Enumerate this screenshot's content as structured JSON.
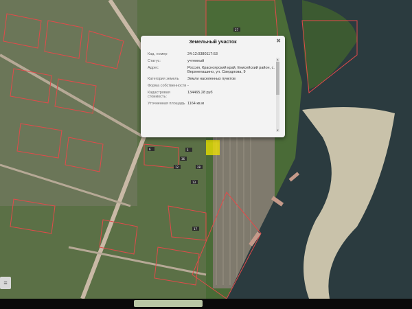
{
  "popup": {
    "title": "Земельный участок",
    "close_icon": "close-icon",
    "rows": [
      {
        "label": "Кад. номер",
        "value": "24:12:0380117:53"
      },
      {
        "label": "Статус:",
        "value": "учтенный"
      },
      {
        "label": "Адрес",
        "value": "Россия, Красноярский край, Енисейский район, с. Верхнепашино, ул. Свердлова, 9"
      },
      {
        "label": "Категория земель",
        "value": "Земли населенных пунктов"
      },
      {
        "label": "Форма собственности",
        "value": "-"
      },
      {
        "label": "Кадастровая стоимость:",
        "value": "134465.28 руб"
      },
      {
        "label": "Уточненная площадь",
        "value": "1164 кв.м"
      }
    ]
  },
  "map": {
    "parcel_labels": [
      "6",
      "36",
      "28",
      "27",
      "17",
      "13",
      "12",
      "5"
    ],
    "colors": {
      "boundary": "#e34a4a",
      "highlight": "#f1e600",
      "river": "#2b3b3f",
      "vegetation": "#456b34"
    }
  },
  "controls": {
    "zoom_icon": "zoom-control-icon"
  }
}
